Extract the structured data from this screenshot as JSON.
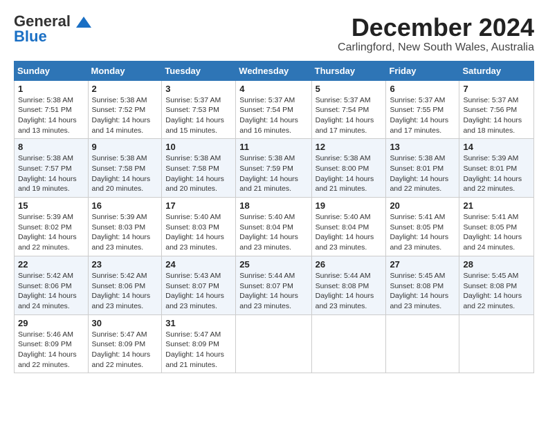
{
  "header": {
    "logo_line1": "General",
    "logo_line2": "Blue",
    "month_title": "December 2024",
    "location": "Carlingford, New South Wales, Australia"
  },
  "days_of_week": [
    "Sunday",
    "Monday",
    "Tuesday",
    "Wednesday",
    "Thursday",
    "Friday",
    "Saturday"
  ],
  "weeks": [
    [
      {
        "day": "1",
        "info": "Sunrise: 5:38 AM\nSunset: 7:51 PM\nDaylight: 14 hours\nand 13 minutes."
      },
      {
        "day": "2",
        "info": "Sunrise: 5:38 AM\nSunset: 7:52 PM\nDaylight: 14 hours\nand 14 minutes."
      },
      {
        "day": "3",
        "info": "Sunrise: 5:37 AM\nSunset: 7:53 PM\nDaylight: 14 hours\nand 15 minutes."
      },
      {
        "day": "4",
        "info": "Sunrise: 5:37 AM\nSunset: 7:54 PM\nDaylight: 14 hours\nand 16 minutes."
      },
      {
        "day": "5",
        "info": "Sunrise: 5:37 AM\nSunset: 7:54 PM\nDaylight: 14 hours\nand 17 minutes."
      },
      {
        "day": "6",
        "info": "Sunrise: 5:37 AM\nSunset: 7:55 PM\nDaylight: 14 hours\nand 17 minutes."
      },
      {
        "day": "7",
        "info": "Sunrise: 5:37 AM\nSunset: 7:56 PM\nDaylight: 14 hours\nand 18 minutes."
      }
    ],
    [
      {
        "day": "8",
        "info": "Sunrise: 5:38 AM\nSunset: 7:57 PM\nDaylight: 14 hours\nand 19 minutes."
      },
      {
        "day": "9",
        "info": "Sunrise: 5:38 AM\nSunset: 7:58 PM\nDaylight: 14 hours\nand 20 minutes."
      },
      {
        "day": "10",
        "info": "Sunrise: 5:38 AM\nSunset: 7:58 PM\nDaylight: 14 hours\nand 20 minutes."
      },
      {
        "day": "11",
        "info": "Sunrise: 5:38 AM\nSunset: 7:59 PM\nDaylight: 14 hours\nand 21 minutes."
      },
      {
        "day": "12",
        "info": "Sunrise: 5:38 AM\nSunset: 8:00 PM\nDaylight: 14 hours\nand 21 minutes."
      },
      {
        "day": "13",
        "info": "Sunrise: 5:38 AM\nSunset: 8:01 PM\nDaylight: 14 hours\nand 22 minutes."
      },
      {
        "day": "14",
        "info": "Sunrise: 5:39 AM\nSunset: 8:01 PM\nDaylight: 14 hours\nand 22 minutes."
      }
    ],
    [
      {
        "day": "15",
        "info": "Sunrise: 5:39 AM\nSunset: 8:02 PM\nDaylight: 14 hours\nand 22 minutes."
      },
      {
        "day": "16",
        "info": "Sunrise: 5:39 AM\nSunset: 8:03 PM\nDaylight: 14 hours\nand 23 minutes."
      },
      {
        "day": "17",
        "info": "Sunrise: 5:40 AM\nSunset: 8:03 PM\nDaylight: 14 hours\nand 23 minutes."
      },
      {
        "day": "18",
        "info": "Sunrise: 5:40 AM\nSunset: 8:04 PM\nDaylight: 14 hours\nand 23 minutes."
      },
      {
        "day": "19",
        "info": "Sunrise: 5:40 AM\nSunset: 8:04 PM\nDaylight: 14 hours\nand 23 minutes."
      },
      {
        "day": "20",
        "info": "Sunrise: 5:41 AM\nSunset: 8:05 PM\nDaylight: 14 hours\nand 23 minutes."
      },
      {
        "day": "21",
        "info": "Sunrise: 5:41 AM\nSunset: 8:05 PM\nDaylight: 14 hours\nand 24 minutes."
      }
    ],
    [
      {
        "day": "22",
        "info": "Sunrise: 5:42 AM\nSunset: 8:06 PM\nDaylight: 14 hours\nand 24 minutes."
      },
      {
        "day": "23",
        "info": "Sunrise: 5:42 AM\nSunset: 8:06 PM\nDaylight: 14 hours\nand 23 minutes."
      },
      {
        "day": "24",
        "info": "Sunrise: 5:43 AM\nSunset: 8:07 PM\nDaylight: 14 hours\nand 23 minutes."
      },
      {
        "day": "25",
        "info": "Sunrise: 5:44 AM\nSunset: 8:07 PM\nDaylight: 14 hours\nand 23 minutes."
      },
      {
        "day": "26",
        "info": "Sunrise: 5:44 AM\nSunset: 8:08 PM\nDaylight: 14 hours\nand 23 minutes."
      },
      {
        "day": "27",
        "info": "Sunrise: 5:45 AM\nSunset: 8:08 PM\nDaylight: 14 hours\nand 23 minutes."
      },
      {
        "day": "28",
        "info": "Sunrise: 5:45 AM\nSunset: 8:08 PM\nDaylight: 14 hours\nand 22 minutes."
      }
    ],
    [
      {
        "day": "29",
        "info": "Sunrise: 5:46 AM\nSunset: 8:09 PM\nDaylight: 14 hours\nand 22 minutes."
      },
      {
        "day": "30",
        "info": "Sunrise: 5:47 AM\nSunset: 8:09 PM\nDaylight: 14 hours\nand 22 minutes."
      },
      {
        "day": "31",
        "info": "Sunrise: 5:47 AM\nSunset: 8:09 PM\nDaylight: 14 hours\nand 21 minutes."
      },
      {
        "day": "",
        "info": ""
      },
      {
        "day": "",
        "info": ""
      },
      {
        "day": "",
        "info": ""
      },
      {
        "day": "",
        "info": ""
      }
    ]
  ]
}
